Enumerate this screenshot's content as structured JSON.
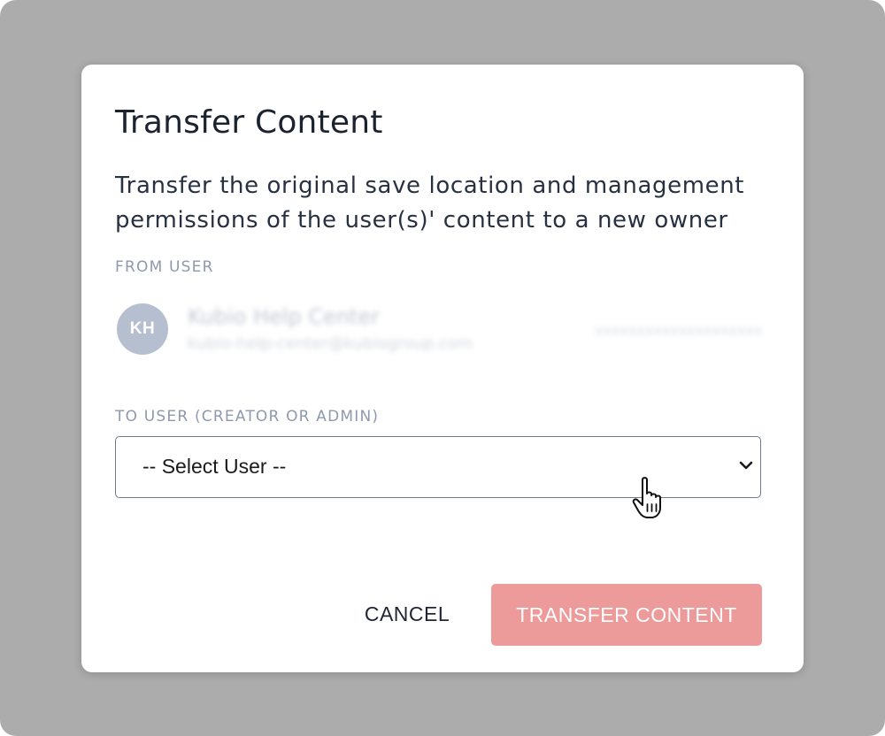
{
  "dialog": {
    "title": "Transfer Content",
    "description": "Transfer the original save location and management permissions of the user(s)' content to a new owner"
  },
  "from_user": {
    "label": "FROM USER",
    "avatar_initials": "KH",
    "name": "Kubio Help Center",
    "email": "kubio-help-center@kubiogroup.com",
    "meta": "xxxxxxxxxxxxxxxxxxxx"
  },
  "to_user": {
    "label": "TO USER (CREATOR OR ADMIN)",
    "selected_value": "-- Select User --"
  },
  "actions": {
    "cancel_label": "CANCEL",
    "transfer_label": "TRANSFER CONTENT"
  },
  "colors": {
    "backdrop": "#acacac",
    "primary_disabled": "#ec9a9a",
    "label": "#8e99ad",
    "avatar": "#b6bfcf"
  }
}
